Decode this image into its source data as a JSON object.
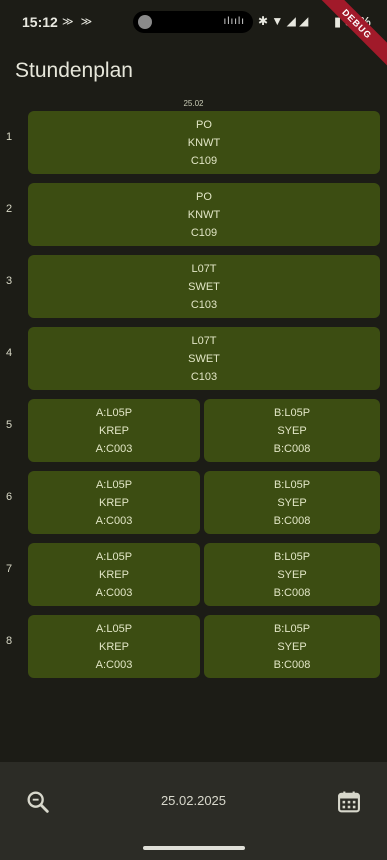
{
  "status_bar": {
    "time": "15:12",
    "notifications": "≫ ≫",
    "pill_bars": "ılıılı",
    "icons": "✱ ▼ ◢ ◢",
    "battery": "▮ 67%"
  },
  "debug_banner": "DEBUG",
  "app_title": "Stundenplan",
  "date_header": "25.02",
  "periods": [
    {
      "number": "1",
      "cells": [
        {
          "lines": [
            "PO",
            "KNWT",
            "C109"
          ]
        }
      ]
    },
    {
      "number": "2",
      "cells": [
        {
          "lines": [
            "PO",
            "KNWT",
            "C109"
          ]
        }
      ]
    },
    {
      "number": "3",
      "cells": [
        {
          "lines": [
            "L07T",
            "SWET",
            "C103"
          ]
        }
      ]
    },
    {
      "number": "4",
      "cells": [
        {
          "lines": [
            "L07T",
            "SWET",
            "C103"
          ]
        }
      ]
    },
    {
      "number": "5",
      "cells": [
        {
          "lines": [
            "A:L05P",
            "KREP",
            "A:C003"
          ]
        },
        {
          "lines": [
            "B:L05P",
            "SYEP",
            "B:C008"
          ]
        }
      ]
    },
    {
      "number": "6",
      "cells": [
        {
          "lines": [
            "A:L05P",
            "KREP",
            "A:C003"
          ]
        },
        {
          "lines": [
            "B:L05P",
            "SYEP",
            "B:C008"
          ]
        }
      ]
    },
    {
      "number": "7",
      "cells": [
        {
          "lines": [
            "A:L05P",
            "KREP",
            "A:C003"
          ]
        },
        {
          "lines": [
            "B:L05P",
            "SYEP",
            "B:C008"
          ]
        }
      ]
    },
    {
      "number": "8",
      "cells": [
        {
          "lines": [
            "A:L05P",
            "KREP",
            "A:C003"
          ]
        },
        {
          "lines": [
            "B:L05P",
            "SYEP",
            "B:C008"
          ]
        }
      ]
    }
  ],
  "bottom_bar": {
    "date": "25.02.2025",
    "search_icon": "search-icon",
    "calendar_icon": "calendar-icon"
  },
  "colors": {
    "background": "#1c1c16",
    "cell": "#3c4d12",
    "bottom_bar": "#2c2c26",
    "debug": "#a11a2a"
  }
}
